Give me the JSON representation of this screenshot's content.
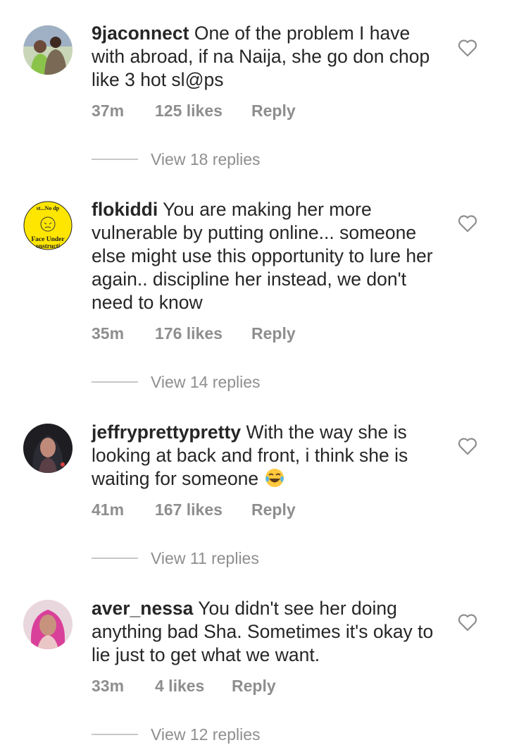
{
  "comments": [
    {
      "username": "9jaconnect",
      "text": "One of the problem I have with abroad, if na Naija, she go don chop like 3 hot sl@ps",
      "time": "37m",
      "likes": "125 likes",
      "reply_label": "Reply",
      "view_replies": "View 18 replies",
      "avatar": "couple-photo-avatar"
    },
    {
      "username": "flokiddi",
      "text": "You are making her more vulnerable  by putting online... someone else might use this opportunity to lure her again.. discipline her instead,  we don't need to know",
      "time": "35m",
      "likes": "176 likes",
      "reply_label": "Reply",
      "view_replies": "View 14 replies",
      "avatar": "yellow-sign-avatar",
      "avatar_text_top": "st...No dp",
      "avatar_text_bottom": "Face Under",
      "avatar_text_bottom2": "onstructi"
    },
    {
      "username": "jeffryprettypretty",
      "text": "With the way she is looking at back and front, i think she is waiting for someone",
      "text_emoji": "laughing-tears-emoji",
      "time": "41m",
      "likes": "167 likes",
      "reply_label": "Reply",
      "view_replies": "View 11 replies",
      "avatar": "woman-photo-avatar"
    },
    {
      "username": "aver_nessa",
      "text": "You didn't see her doing anything bad Sha. Sometimes it's okay to lie just to get what we want.",
      "time": "33m",
      "likes": "4 likes",
      "reply_label": "Reply",
      "view_replies": "View 12 replies",
      "avatar": "pink-hair-avatar"
    }
  ],
  "colors": {
    "text": "#262626",
    "meta": "#8e8e8e",
    "divider": "#c7c7c7",
    "avatar_yellow": "#ffe600"
  }
}
